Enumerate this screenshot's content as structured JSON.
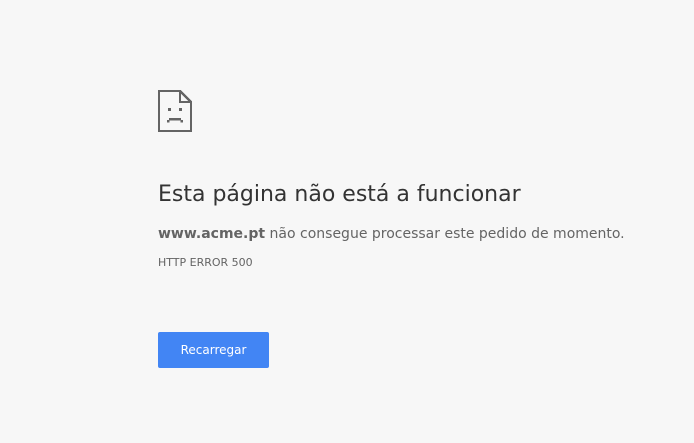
{
  "error_page": {
    "icon": "sad-page-icon",
    "title": "Esta página não está a funcionar",
    "domain": "www.acme.pt",
    "message_rest": " não consegue processar este pedido de momento.",
    "error_code": "HTTP ERROR 500",
    "reload_label": "Recarregar"
  },
  "colors": {
    "background": "#f7f7f7",
    "button": "#4285f4",
    "title_text": "#333333",
    "body_text": "#646464"
  }
}
